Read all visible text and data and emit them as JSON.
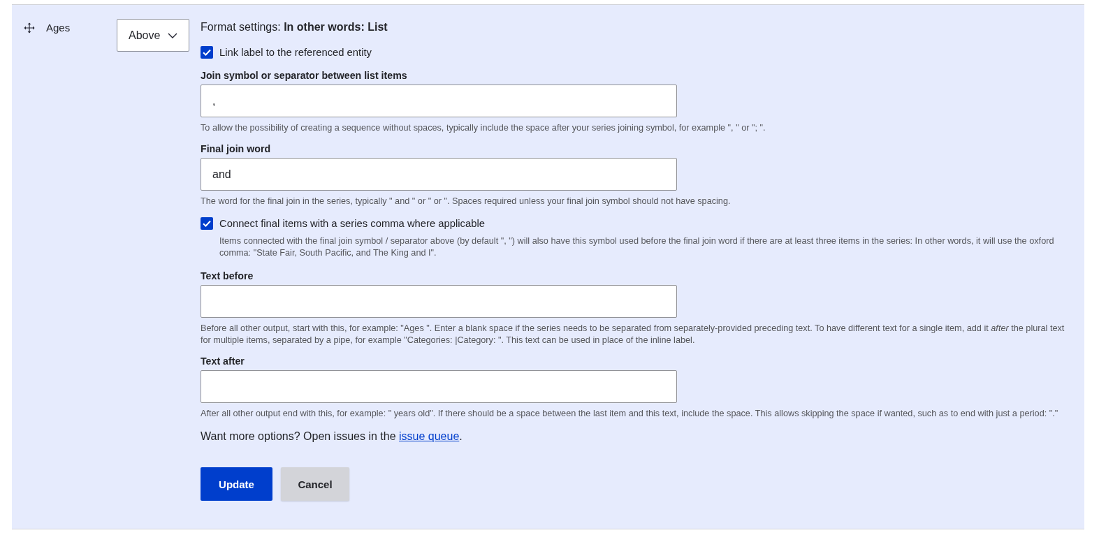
{
  "row": {
    "label": "Ages",
    "label_display": {
      "value": "Above"
    }
  },
  "format_settings": {
    "title": "Format settings: **In other words: List**"
  },
  "settings": [
    {
      "kind": "checkbox",
      "label": "Link label to the referenced entity",
      "checked": true
    },
    {
      "kind": "text",
      "label": "Join symbol or separator between list items",
      "value": ",",
      "description": "To allow the possibility of creating a sequence without spaces, typically include the space after your series joining symbol, for example \", \" or \"; \"."
    },
    {
      "kind": "text",
      "label": "Final join word",
      "value": "and",
      "description": "The word for the final join in the series, typically \" and \" or \" or \". Spaces required unless your final join symbol should not have spacing."
    },
    {
      "kind": "checkbox",
      "label": "Connect final items with a series comma where applicable",
      "checked": true,
      "description": "Items connected with the final join symbol / separator above (by default \", \") will also have this symbol used before the final join word if there are at least three items in the series: In other words, it will use the oxford comma: \"State Fair, South Pacific, and The King and I\"."
    },
    {
      "kind": "text",
      "label": "Text before",
      "description": "Before all other output, start with this, for example: \"Ages \". Enter a blank space if the series needs to be separated from separately-provided preceding text. To have different text for a single item, add it *after* the plural text for multiple items, separated by a pipe, for example \"Categories: |Category: \". This text can be used in place of the inline label."
    },
    {
      "kind": "text",
      "label": "Text after",
      "description": "After all other output end with this, for example: \" years old\". If there should be a space between the last item and this text, include the space. This allows skipping the space if wanted, such as to end with just a period: \".\""
    }
  ],
  "more_options": {
    "text": "Want more options? Open issues in the",
    "link": "issue queue",
    "suffix": "."
  },
  "buttons": [
    {
      "label": "Update",
      "kind": "primary"
    },
    {
      "label": "Cancel",
      "kind": "secondary"
    }
  ]
}
